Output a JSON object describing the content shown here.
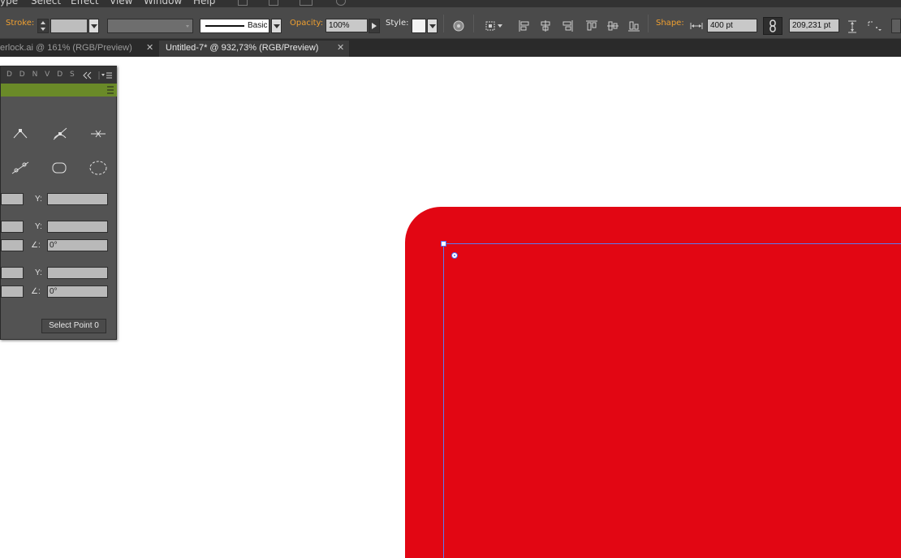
{
  "menubar": {
    "items": [
      "ype",
      "Select",
      "Effect",
      "View",
      "Window",
      "Help"
    ]
  },
  "controlbar": {
    "stroke_label": "Stroke:",
    "brush_style": "Basic",
    "opacity_label": "Opacity:",
    "opacity_value": "100%",
    "style_label": "Style:",
    "shape_label": "Shape:",
    "width_value": "400 pt",
    "height_value": "209,231 pt"
  },
  "tabs": [
    {
      "label": "erlock.ai @ 161% (RGB/Preview)",
      "active": false
    },
    {
      "label": "Untitled-7* @ 932,73% (RGB/Preview)",
      "active": true
    }
  ],
  "panel": {
    "header_letters": "D D N V D S",
    "y_label": "Y:",
    "angle_label": "∠:",
    "angle_value_1": "0°",
    "angle_value_2": "0°",
    "select_point_label": "Select Point 0"
  },
  "canvas": {
    "shape_color": "#e20613",
    "guide_color": "#5a7cf2"
  }
}
